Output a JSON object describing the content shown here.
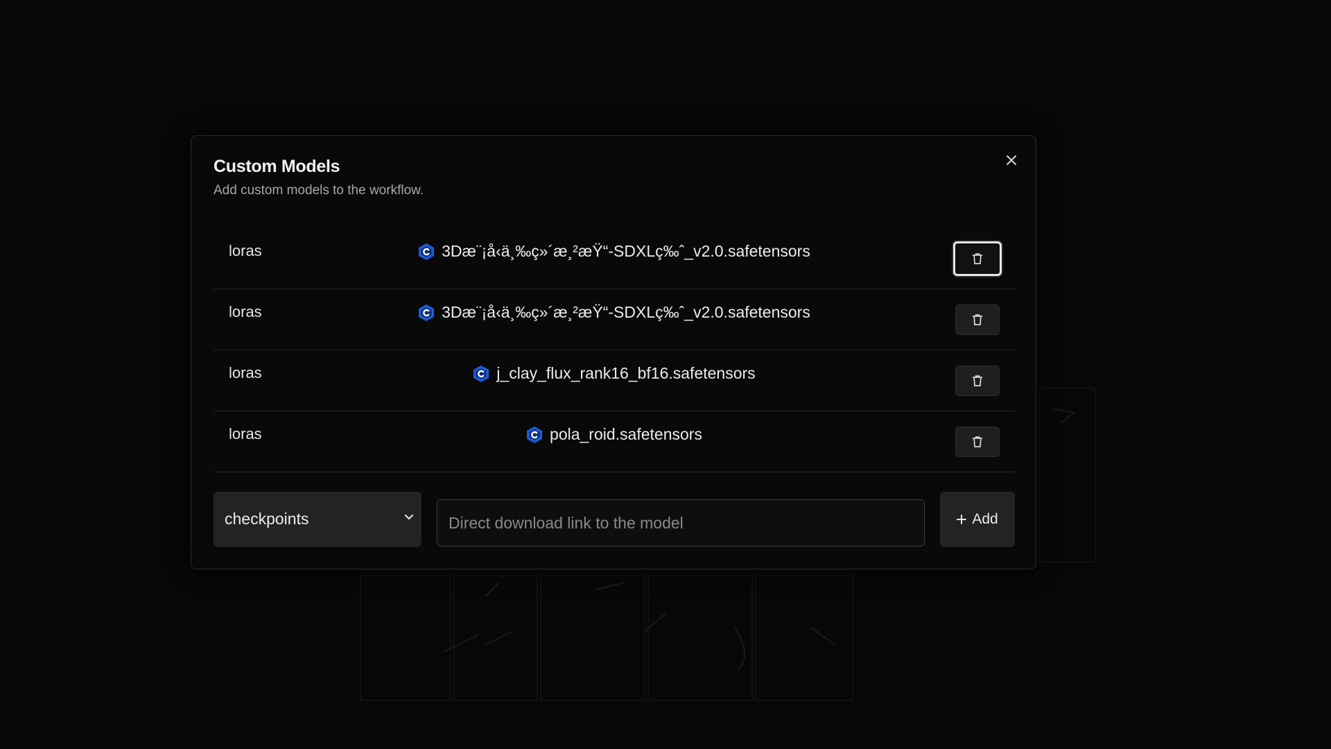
{
  "modal": {
    "title": "Custom Models",
    "subtitle": "Add custom models to the workflow.",
    "close_icon": "close-icon"
  },
  "models": [
    {
      "type": "loras",
      "filename": "3Dæ¨¡å‹ä¸‰ç»´æ¸²æŸ“-SDXLç‰ˆ_v2.0.safetensors",
      "source_icon": "civitai-icon",
      "focused": true
    },
    {
      "type": "loras",
      "filename": "3Dæ¨¡å‹ä¸‰ç»´æ¸²æŸ“-SDXLç‰ˆ_v2.0.safetensors",
      "source_icon": "civitai-icon",
      "focused": false
    },
    {
      "type": "loras",
      "filename": "j_clay_flux_rank16_bf16.safetensors",
      "source_icon": "civitai-icon",
      "focused": false
    },
    {
      "type": "loras",
      "filename": "pola_roid.safetensors",
      "source_icon": "civitai-icon",
      "focused": false
    }
  ],
  "add_form": {
    "selected_type": "checkpoints",
    "url_value": "",
    "url_placeholder": "Direct download link to the model",
    "add_label": "Add",
    "add_icon": "plus-icon"
  },
  "colors": {
    "overlay_bg": "#070707",
    "modal_bg": "#090909",
    "civitai_blue": "#1c5bd8",
    "button_bg": "#232323"
  }
}
